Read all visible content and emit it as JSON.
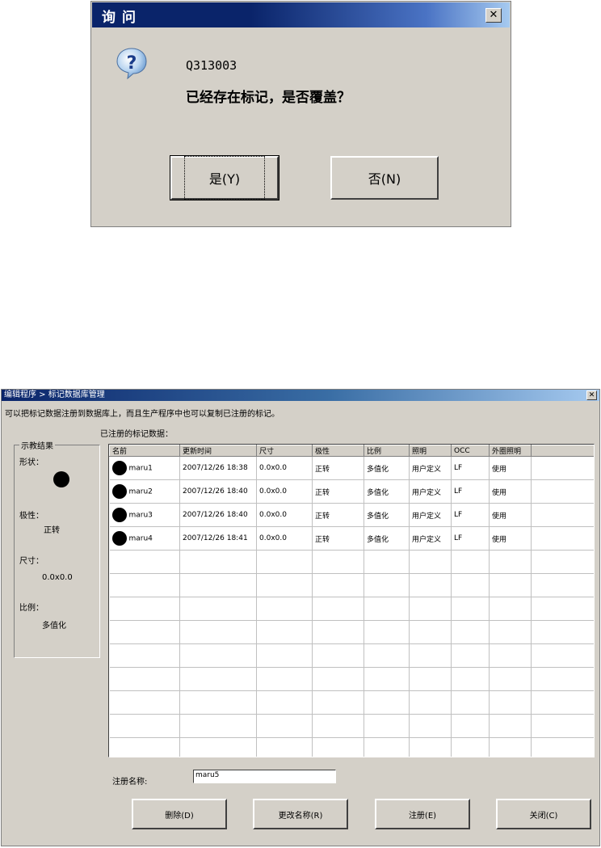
{
  "dialog": {
    "title": "询问",
    "close": "✕",
    "code": "Q313003",
    "message": "已经存在标记，是否覆盖？",
    "yes_label": "是(Y)",
    "no_label": "否(N)"
  },
  "manager": {
    "title": "编辑程序 > 标记数据库管理",
    "close": "✕",
    "description": "可以把标记数据注册到数据库上，而且生产程序中也可以复制已注册的标记。",
    "registered_label": "已注册的标记数据：",
    "result": {
      "title": "示教结果",
      "shape_label": "形状：",
      "polarity_label": "极性：",
      "polarity_value": "正转",
      "size_label": "尺寸：",
      "size_value": "0.0x0.0",
      "ratio_label": "比例：",
      "ratio_value": "多值化"
    },
    "columns": [
      "名前",
      "更新时间",
      "尺寸",
      "极性",
      "比例",
      "照明",
      "OCC",
      "外圈照明"
    ],
    "rows": [
      {
        "name": "maru1",
        "time": "2007/12/26 18:38",
        "size": "0.0x0.0",
        "polarity": "正转",
        "ratio": "多值化",
        "light": "用户定义",
        "occ": "LF",
        "outer": "使用"
      },
      {
        "name": "maru2",
        "time": "2007/12/26 18:40",
        "size": "0.0x0.0",
        "polarity": "正转",
        "ratio": "多值化",
        "light": "用户定义",
        "occ": "LF",
        "outer": "使用"
      },
      {
        "name": "maru3",
        "time": "2007/12/26 18:40",
        "size": "0.0x0.0",
        "polarity": "正转",
        "ratio": "多值化",
        "light": "用户定义",
        "occ": "LF",
        "outer": "使用"
      },
      {
        "name": "maru4",
        "time": "2007/12/26 18:41",
        "size": "0.0x0.0",
        "polarity": "正转",
        "ratio": "多值化",
        "light": "用户定义",
        "occ": "LF",
        "outer": "使用"
      }
    ],
    "register_name_label": "注册名称:",
    "register_name_value": "maru5",
    "buttons": {
      "delete": "删除(D)",
      "rename": "更改名称(R)",
      "register": "注册(E)",
      "close": "关闭(C)"
    }
  }
}
